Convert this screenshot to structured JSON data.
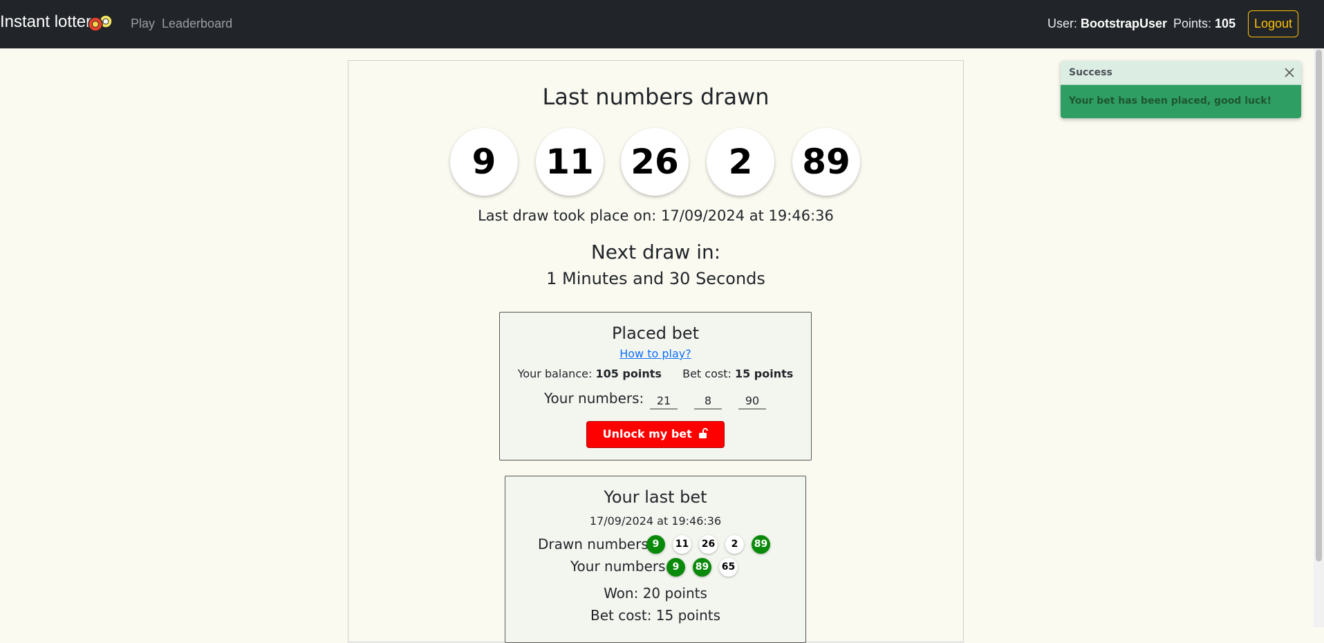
{
  "navbar": {
    "brand": "Instant lottery",
    "links": [
      "Play",
      "Leaderboard"
    ],
    "user_label": "User:",
    "user_name": "BootstrapUser",
    "points_label": "Points:",
    "points_value": "105",
    "logout_label": "Logout"
  },
  "draw": {
    "title": "Last numbers drawn",
    "numbers": [
      "9",
      "11",
      "26",
      "2",
      "89"
    ],
    "last_draw_text": "Last draw took place on: 17/09/2024 at 19:46:36",
    "next_title": "Next draw in:",
    "countdown": "1 Minutes and 30 Seconds"
  },
  "placed_bet": {
    "title": "Placed bet",
    "how_to_play": "How to play?",
    "balance_label": "Your balance:",
    "balance_value": "105 points",
    "cost_label": "Bet cost:",
    "cost_value": "15 points",
    "numbers_label": "Your numbers:",
    "numbers": [
      "21",
      "8",
      "90"
    ],
    "unlock_label": "Unlock my bet"
  },
  "last_bet": {
    "title": "Your last bet",
    "date": "17/09/2024 at 19:46:36",
    "drawn_label": "Drawn numbers:",
    "drawn": [
      {
        "value": "9",
        "hit": true
      },
      {
        "value": "11",
        "hit": false
      },
      {
        "value": "26",
        "hit": false
      },
      {
        "value": "2",
        "hit": false
      },
      {
        "value": "89",
        "hit": true
      }
    ],
    "yours_label": "Your numbers:",
    "yours": [
      {
        "value": "9",
        "hit": true
      },
      {
        "value": "89",
        "hit": true
      },
      {
        "value": "65",
        "hit": false
      }
    ],
    "won": "Won: 20 points",
    "bet_cost": "Bet cost: 15 points"
  },
  "toast": {
    "title": "Success",
    "message": "Your bet has been placed, good luck!"
  },
  "colors": {
    "navbar": "#212529",
    "background": "#fbfaf1",
    "accent_logout": "#ffc107",
    "unlock_button": "#ff0000",
    "hit_ball": "#0a8a0a",
    "toast_body": "#2e9e62"
  }
}
